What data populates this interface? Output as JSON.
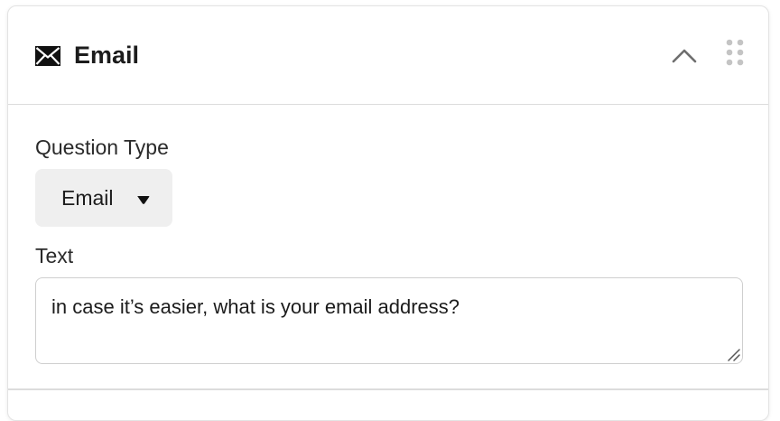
{
  "card": {
    "title": "Email",
    "title_icon": "envelope-icon",
    "collapse_icon": "chevron-up-icon",
    "drag_icon": "drag-handle-icon"
  },
  "question_type": {
    "label": "Question Type",
    "selected": "Email",
    "caret_icon": "caret-down-icon"
  },
  "text_field": {
    "label": "Text",
    "value": "in case it’s easier, what is your email address?"
  },
  "colors": {
    "select_bg": "#efefef",
    "border": "#cfcfcf",
    "icon_gray": "#b5b5b5"
  }
}
